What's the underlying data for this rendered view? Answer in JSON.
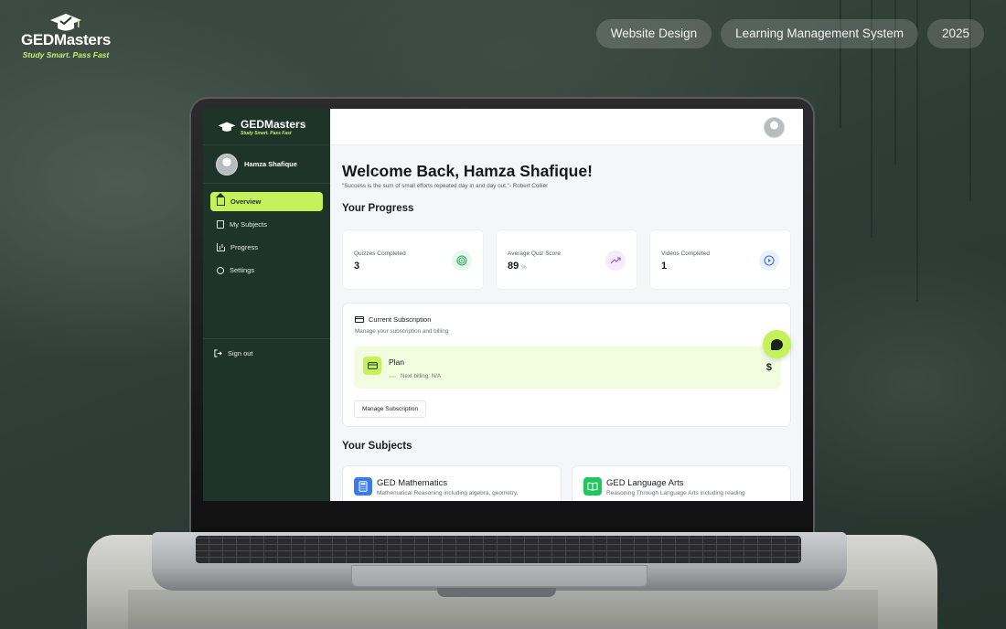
{
  "brand": {
    "name": "GEDMasters",
    "tagline": "Study Smart. Pass Fast"
  },
  "tags": [
    "Website Design",
    "Learning Management System",
    "2025"
  ],
  "colors": {
    "accent": "#c5f15a",
    "sidebar": "#1f3428",
    "background": "#2f3d37"
  },
  "app": {
    "sidebar": {
      "logo_name": "GEDMasters",
      "logo_tagline": "Study Smart. Pass Fast",
      "user_name": "Hamza Shafique",
      "nav": [
        {
          "label": "Overview",
          "icon": "home-icon",
          "active": true
        },
        {
          "label": "My Subjects",
          "icon": "book-icon"
        },
        {
          "label": "Progress",
          "icon": "bar-chart-icon"
        },
        {
          "label": "Settings",
          "icon": "gear-icon"
        }
      ],
      "sign_out": "Sign out",
      "collapse_glyph": "‹"
    },
    "main": {
      "welcome": "Welcome Back, Hamza Shafique!",
      "quote": "\"Success is the sum of small efforts repeated day in and day out.\"- Robert Collier",
      "progress_title": "Your Progress",
      "stats": [
        {
          "label": "Quizzes Completed",
          "value": "3",
          "unit": "",
          "icon": "target-icon"
        },
        {
          "label": "Average Quiz Score",
          "value": "89",
          "unit": "%",
          "icon": "trending-up-icon"
        },
        {
          "label": "Videos Completed",
          "value": "1",
          "unit": "",
          "icon": "play-icon"
        }
      ],
      "subscription": {
        "title": "Current Subscription",
        "desc": "Manage your subscription and billing",
        "plan": "Plan",
        "next_billing": "Next billing: N/A",
        "price": "$",
        "button": "Manage Subscription"
      },
      "subjects_title": "Your Subjects",
      "subjects": [
        {
          "name": "GED Mathematics",
          "desc": "Mathematical Reasoning including algebra, geometry,",
          "icon": "calculator-icon"
        },
        {
          "name": "GED Language Arts",
          "desc": "Reasoning Through Language Arts including reading",
          "icon": "open-book-icon"
        }
      ]
    }
  }
}
